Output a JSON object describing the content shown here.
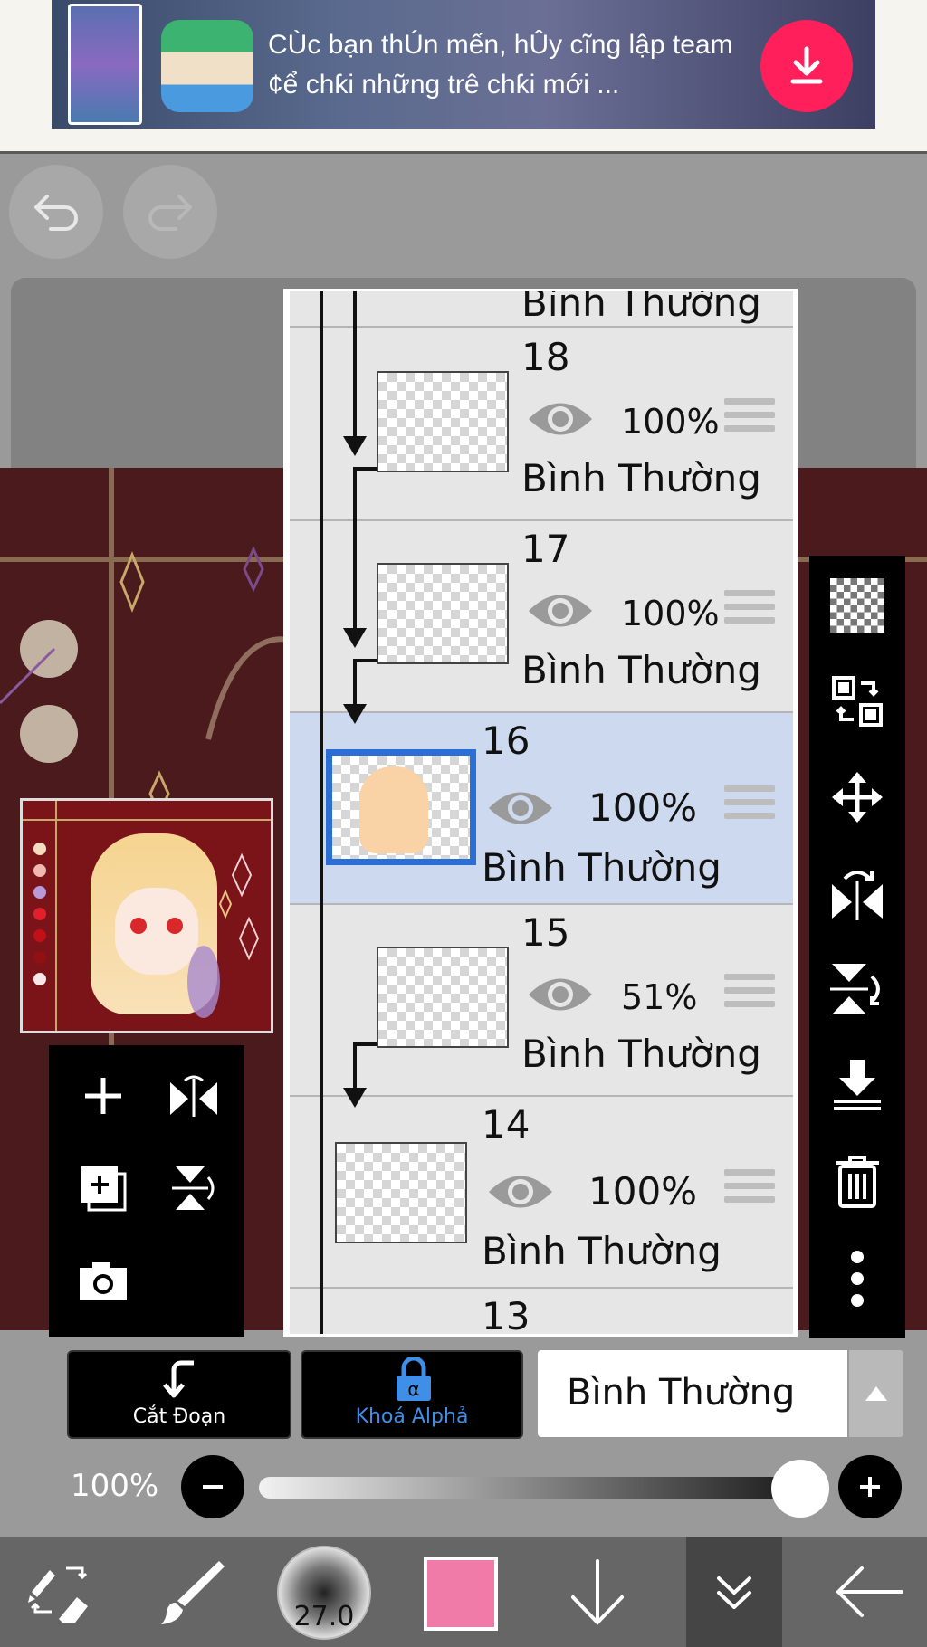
{
  "ad": {
    "text": "CÙc bạn thÚn mến, hÛy cĩng lập team ¢ể chƙi những trê  chƙi mới ...",
    "icon": "download-icon",
    "accent": "#ff1f5a"
  },
  "history": {
    "undo_icon": "undo-icon",
    "redo_icon": "redo-icon"
  },
  "layers": {
    "top_partial_label": "Bình Thường",
    "bottom_partial_number": "13",
    "items": [
      {
        "number": "18",
        "opacity": "100%",
        "blend": "Bình Thường",
        "clipped": true,
        "selected": false
      },
      {
        "number": "17",
        "opacity": "100%",
        "blend": "Bình Thường",
        "clipped": true,
        "selected": false
      },
      {
        "number": "16",
        "opacity": "100%",
        "blend": "Bình Thường",
        "clipped": false,
        "selected": true
      },
      {
        "number": "15",
        "opacity": "51%",
        "blend": "Bình Thường",
        "clipped": true,
        "selected": false
      },
      {
        "number": "14",
        "opacity": "100%",
        "blend": "Bình Thường",
        "clipped": false,
        "selected": false
      }
    ],
    "selection_color": "#2a6ed6"
  },
  "right_toolbar": [
    "transparency-icon",
    "swap-layer-icon",
    "move-icon",
    "flip-horizontal-icon",
    "flip-vertical-icon",
    "merge-down-icon",
    "trash-icon",
    "more-icon"
  ],
  "quick_panel": [
    "add-layer-icon",
    "flip-h-icon",
    "duplicate-layer-icon",
    "flip-v-icon",
    "camera-icon"
  ],
  "mode": {
    "clip_label": "Cắt Đoạn",
    "alpha_label": "Khoá Alphả",
    "alpha_color": "#3f8ee8",
    "blend_value": "Bình Thường"
  },
  "opacity": {
    "label": "100%",
    "value": 1.0
  },
  "bottom_toolbar": {
    "brush_size": "27.0",
    "color": "#f07aa8"
  }
}
